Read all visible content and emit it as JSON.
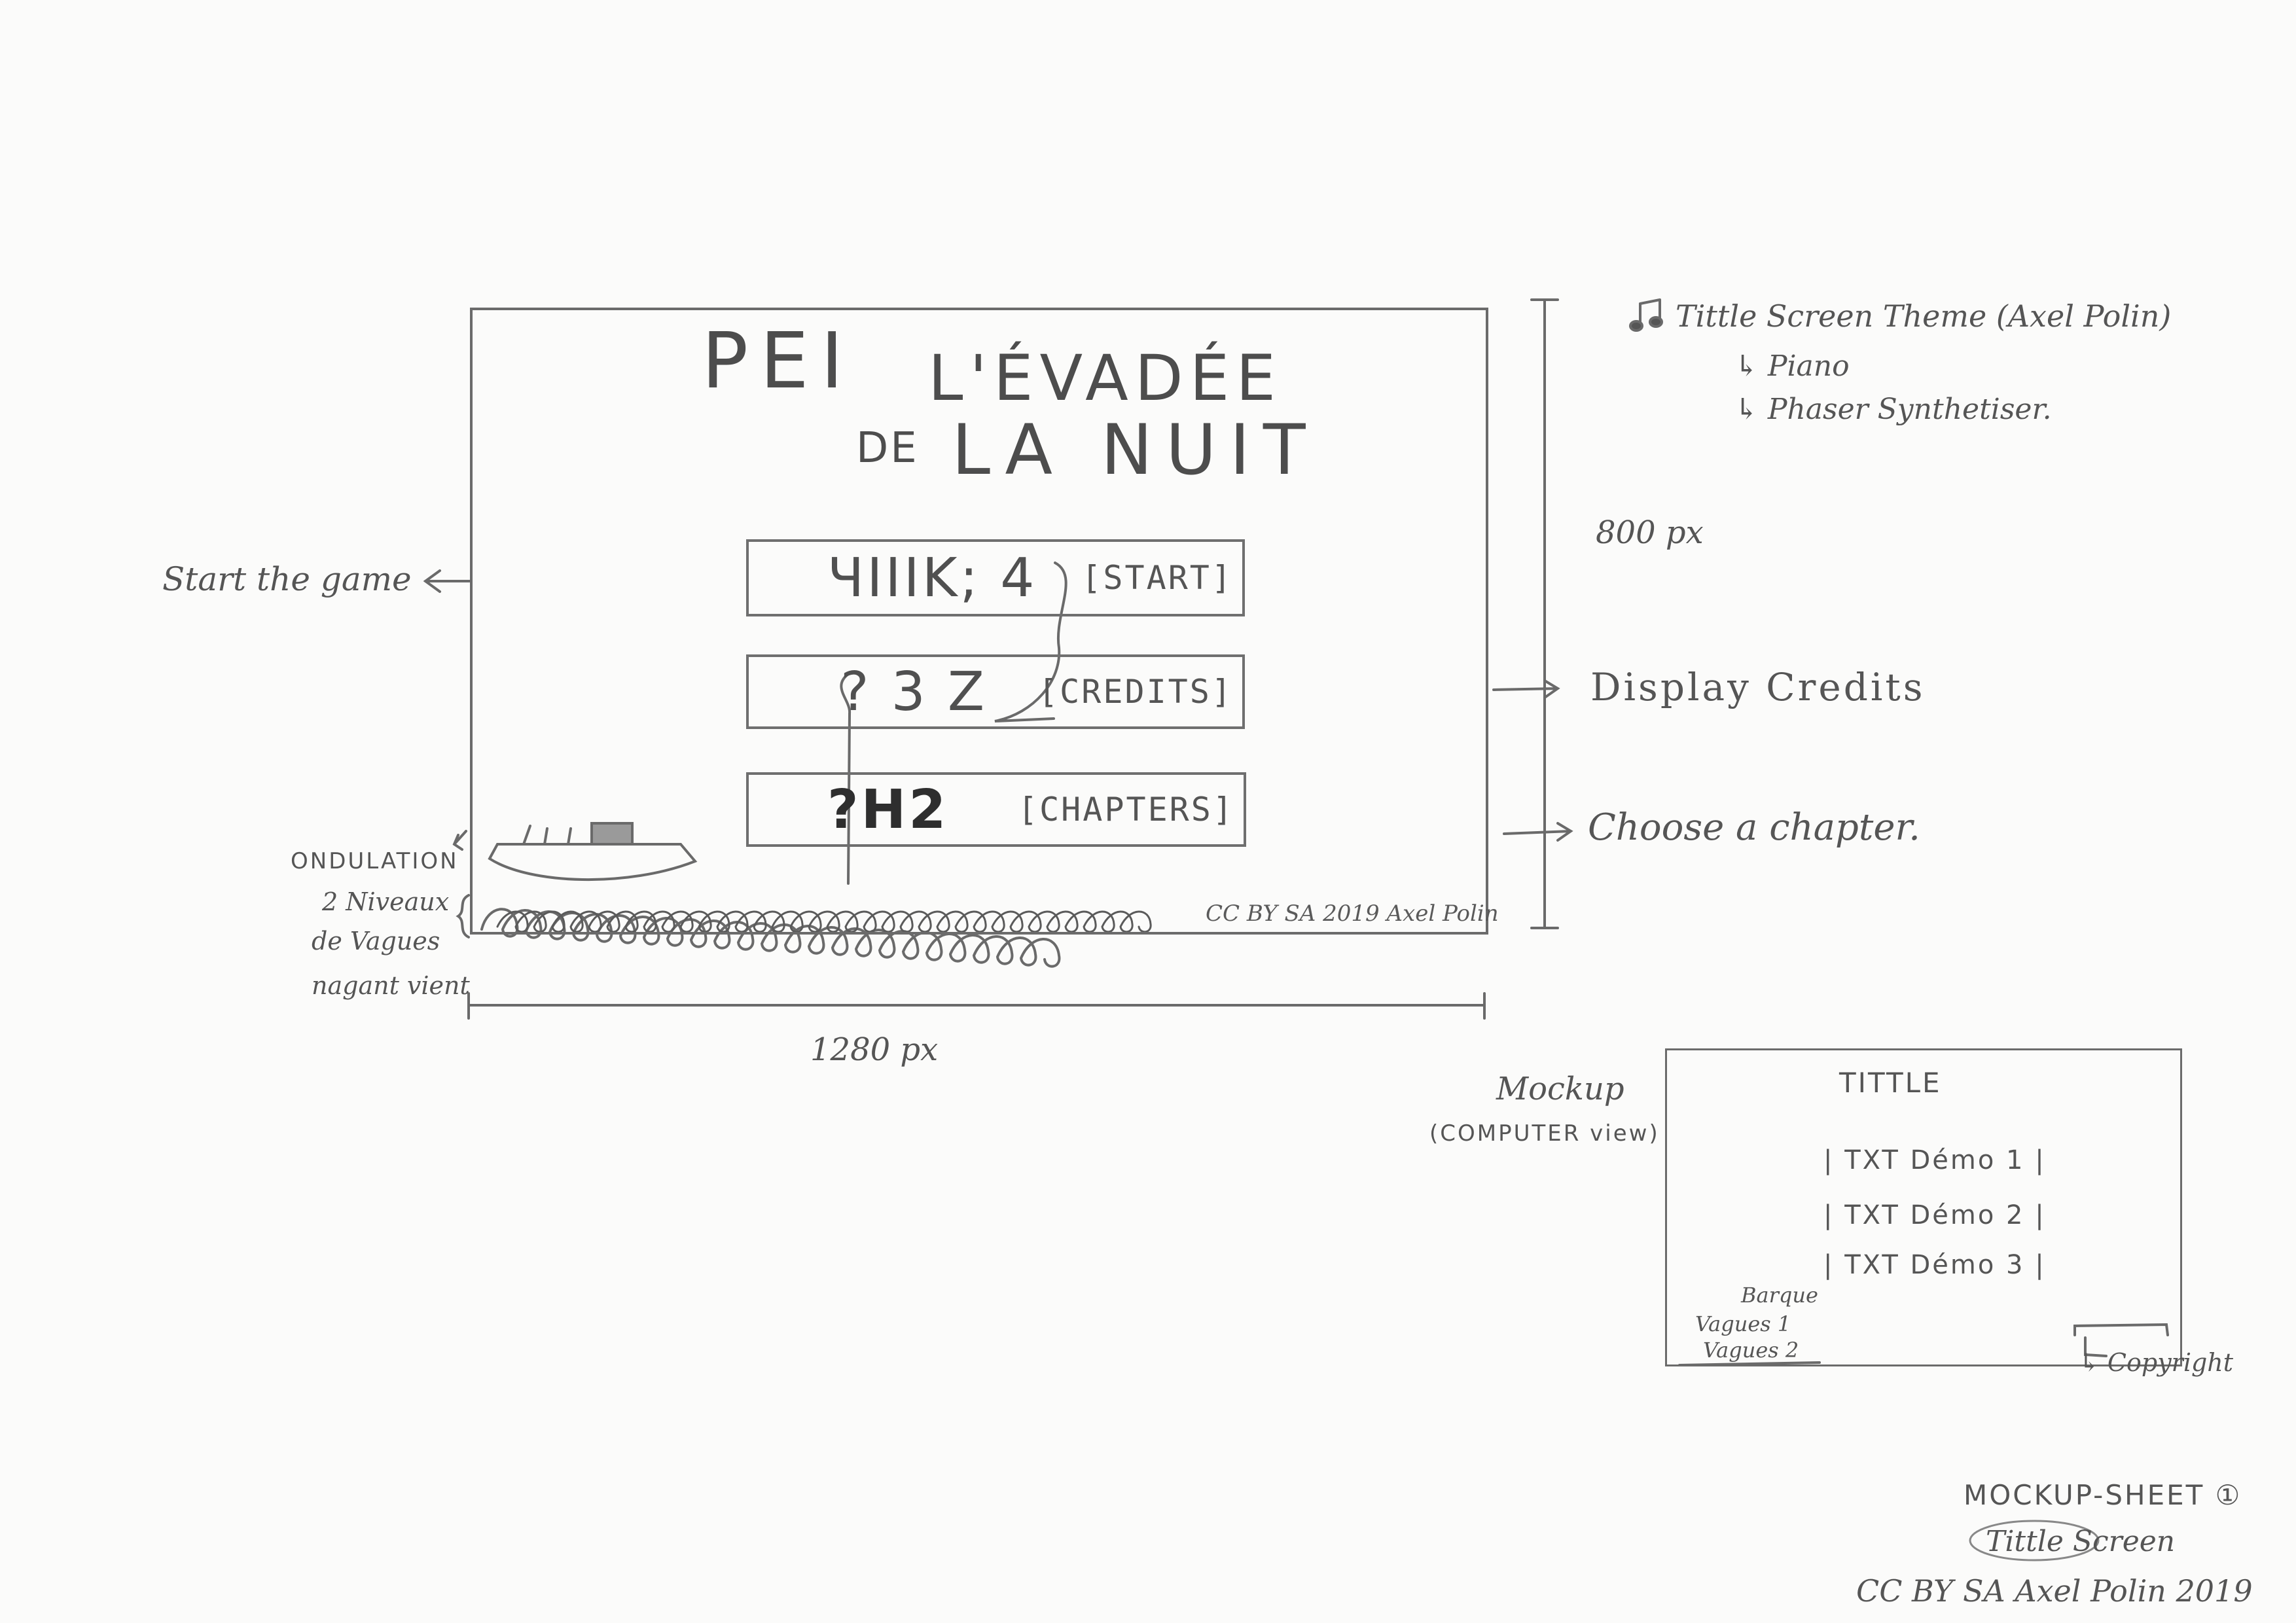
{
  "title_screen": {
    "title_line1_left": "PEI",
    "title_line1_right": "L'ÉVADÉE",
    "title_line2_small": "DE",
    "title_line2": "LA NUIT",
    "buttons": [
      {
        "code": "ЧIIIK; 4",
        "label": "[START]"
      },
      {
        "code": "? 3 Z",
        "label": "[CREDITS]"
      },
      {
        "code": "?H2",
        "label": "[CHAPTERS]"
      }
    ],
    "copyright": "CC BY SA 2019 Axel Polin"
  },
  "annotations": {
    "music_title": "Tittle Screen Theme (Axel Polin)",
    "music_item1": "↳ Piano",
    "music_item2": "↳ Phaser Synthetiser.",
    "height_label": "800 px",
    "width_label": "1280 px",
    "start_note": "Start the game",
    "credits_note": "Display Credits",
    "chapters_note": "Choose a chapter.",
    "ondulation": "ONDULATION",
    "waves_line1": "2 Niveaux",
    "waves_line2": "de Vagues",
    "waves_line3": "nagant vient"
  },
  "mini_mockup": {
    "caption_line1": "Mockup",
    "caption_line2": "(COMPUTER view)",
    "title": "TITTLE",
    "items": [
      "| TXT Démo 1 |",
      "| TXT Démo 2 |",
      "| TXT Démo 3 |"
    ],
    "boat_label": "Barque",
    "wave1_label": "Vagues 1",
    "wave2_label": "Vagues 2",
    "copyright_label": "↳ Copyright"
  },
  "sheet_footer": {
    "line1": "MOCKUP-SHEET ①",
    "line2": "Tittle Screen",
    "line3": "CC BY SA Axel Polin 2019"
  },
  "colors": {
    "paper": "#fbfbfa",
    "pencil": "#555555",
    "pencil_dark": "#3f3f3f"
  }
}
